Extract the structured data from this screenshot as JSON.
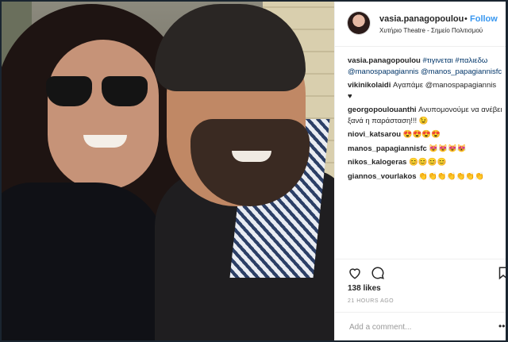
{
  "post": {
    "username": "vasia.panagopoulou",
    "separator": "•",
    "follow_label": "Follow",
    "location": "Χυτήριο Theatre - Σημείο Πολιτισμού"
  },
  "comments": [
    {
      "user": "vasia.panagopoulou",
      "text": " #τιγινεται #παλιεδω",
      "line2": "@manospapagiannis @manos_papagiannisfc"
    },
    {
      "user": "vikinikolaidi",
      "text": " Αγαπάμε @manospapagiannis",
      "line2": "♥"
    },
    {
      "user": "georgopoulouanthi",
      "text": " Ανυπομονούμε να ανέβει",
      "line2": "ξανά η παράσταση!!! 😉"
    },
    {
      "user": "niovi_katsarou",
      "text": " 😍😍😍😍"
    },
    {
      "user": "manos_papagiannisfc",
      "text": " 😻😻😻😻"
    },
    {
      "user": "nikos_kalogeras",
      "text": " 😊😊😊😊"
    },
    {
      "user": "giannos_vourlakos",
      "text": " 👏👏👏👏👏👏👏"
    }
  ],
  "likes": "138 likes",
  "timestamp": "21 HOURS AGO",
  "add_comment_placeholder": "Add a comment...",
  "more_label": "•••",
  "icons": [
    "heart-icon",
    "comment-icon",
    "bookmark-icon"
  ]
}
